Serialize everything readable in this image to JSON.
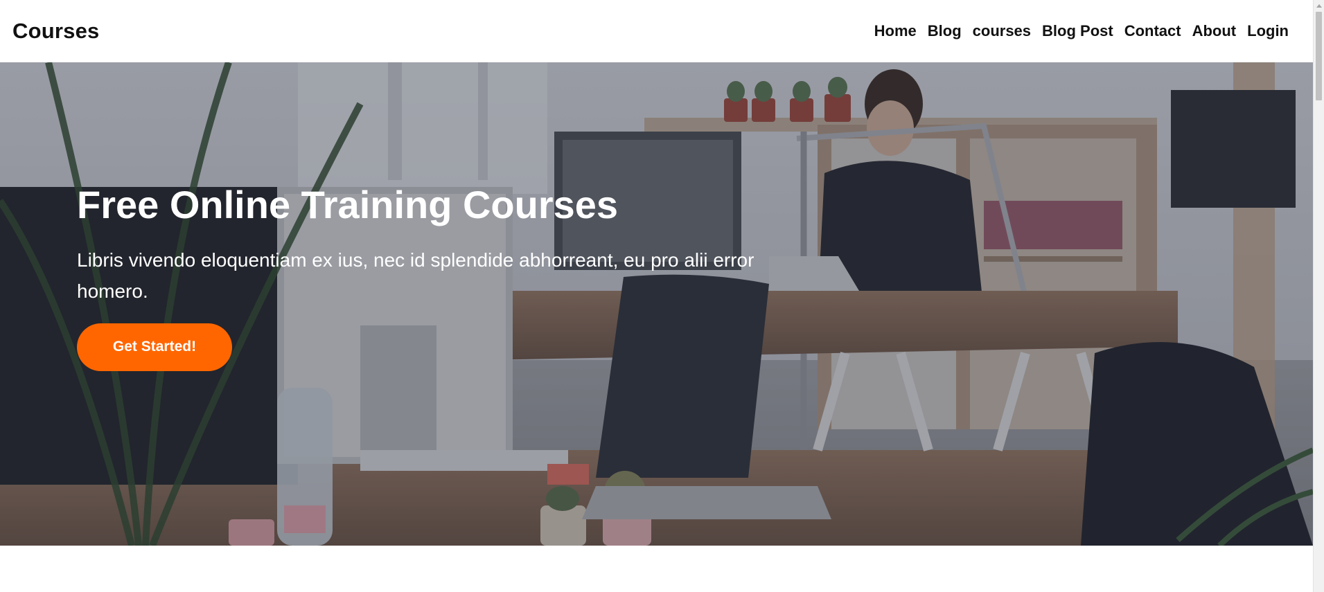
{
  "header": {
    "brand": "Courses",
    "nav": [
      {
        "label": "Home"
      },
      {
        "label": "Blog"
      },
      {
        "label": "courses"
      },
      {
        "label": "Blog Post"
      },
      {
        "label": "Contact"
      },
      {
        "label": "About"
      },
      {
        "label": "Login"
      }
    ]
  },
  "hero": {
    "title": "Free Online Training Courses",
    "text": "Libris vivendo eloquentiam ex ius, nec id splendide abhorreant, eu pro alii error homero.",
    "cta_label": "Get Started!"
  },
  "colors": {
    "accent": "#ff6600",
    "text_dark": "#111111",
    "hero_text": "#ffffff"
  },
  "icons": {
    "scroll_up": "chevron-up-icon"
  }
}
